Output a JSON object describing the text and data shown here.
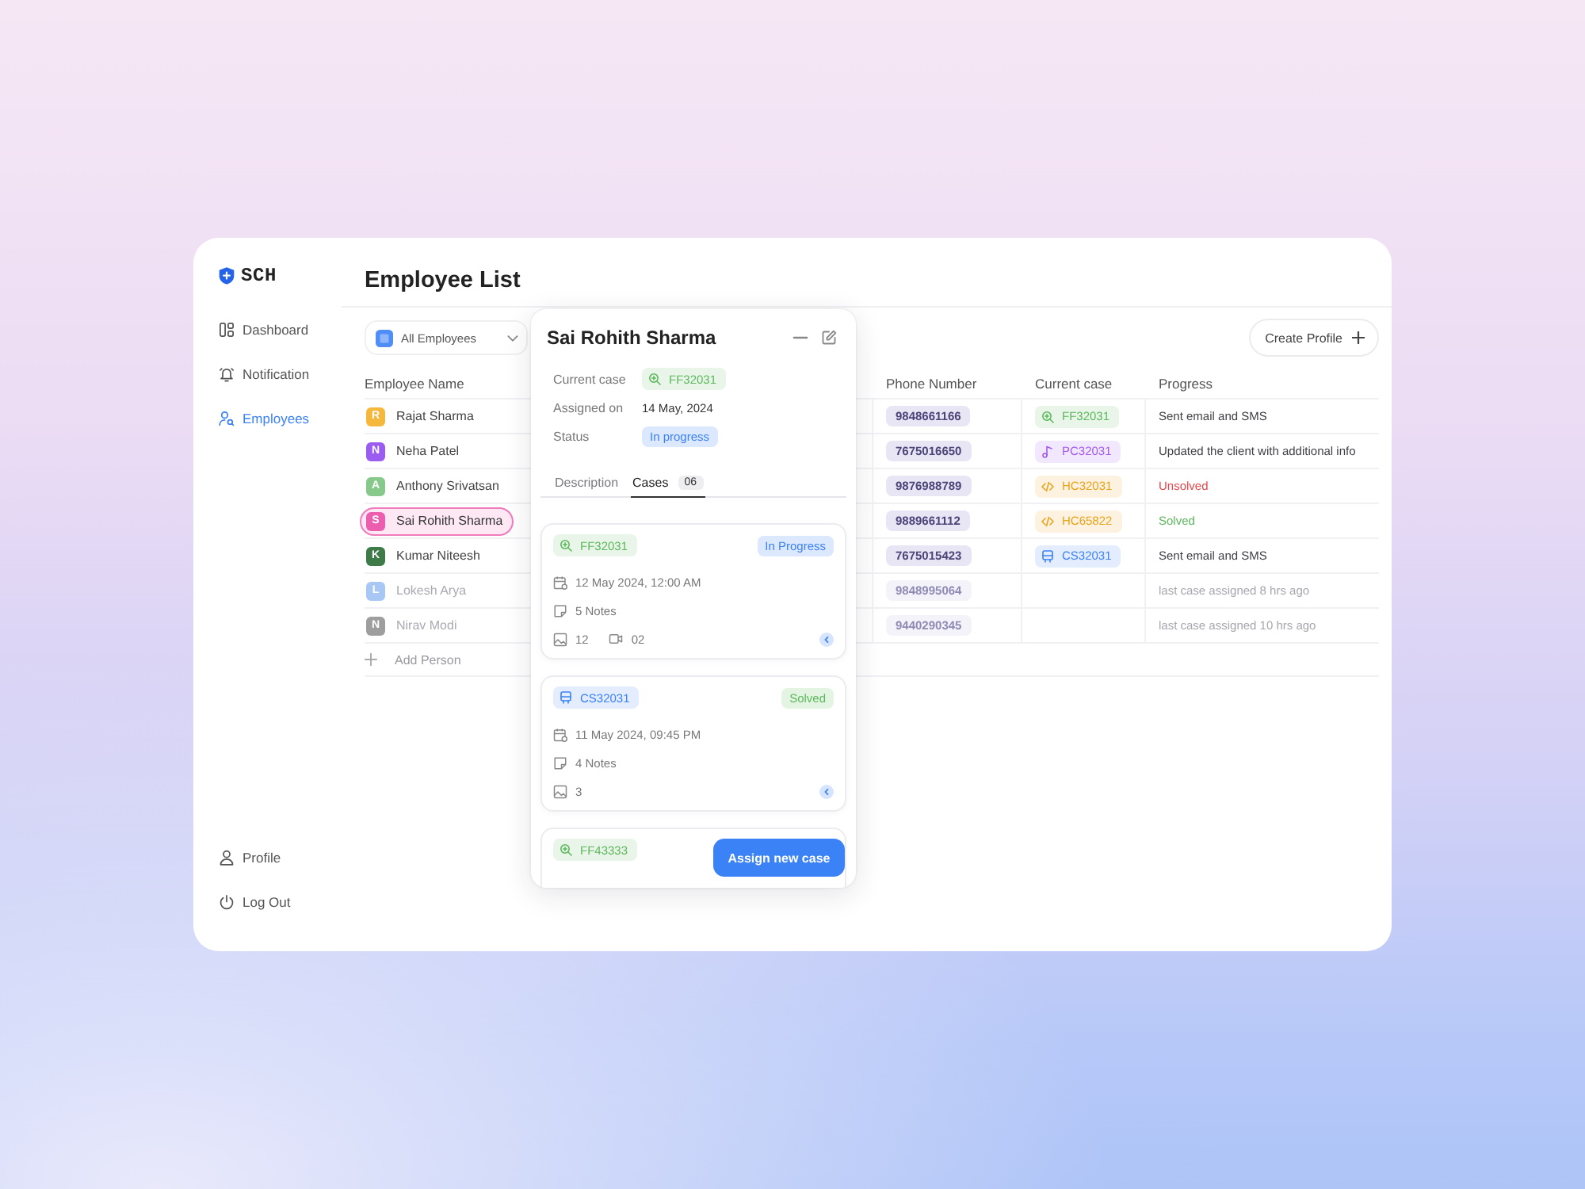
{
  "sidebar": {
    "logo": "SCH",
    "items": [
      {
        "label": "Dashboard",
        "kind": "dashboard",
        "selected": false
      },
      {
        "label": "Notification",
        "kind": "bell",
        "selected": false
      },
      {
        "label": "Employees",
        "kind": "people",
        "selected": true
      }
    ],
    "bottom_items": [
      {
        "label": "Profile",
        "kind": "person"
      },
      {
        "label": "Log Out",
        "kind": "power"
      }
    ]
  },
  "header": {
    "title": "Employee List"
  },
  "toolbar": {
    "filter": "All Employees",
    "create_button": "Create Profile"
  },
  "table": {
    "columns": [
      "Employee Name",
      "Phone Number",
      "Current case",
      "Progress"
    ],
    "rows": [
      {
        "initial": "R",
        "name": "Rajat Sharma",
        "color": "#f5b83d",
        "selected": false,
        "inactive": false,
        "phone": "9848661166",
        "case": {
          "id": "FF32031",
          "kind": "search",
          "color": "#5cb85c"
        },
        "progress": {
          "text": "Sent email and SMS",
          "kind": "normal"
        }
      },
      {
        "initial": "N",
        "name": "Neha Patel",
        "color": "#9b5cf0",
        "selected": false,
        "inactive": false,
        "phone": "7675016650",
        "case": {
          "id": "PC32031",
          "kind": "music",
          "color": "#a259f0"
        },
        "progress": {
          "text": "Updated the client with additional info",
          "kind": "normal"
        }
      },
      {
        "initial": "A",
        "name": "Anthony Srivatsan",
        "color": "#86c98a",
        "selected": false,
        "inactive": false,
        "phone": "9876988789",
        "case": {
          "id": "HC32031",
          "kind": "code",
          "color": "#eaa21c"
        },
        "progress": {
          "text": "Unsolved",
          "kind": "danger"
        }
      },
      {
        "initial": "S",
        "name": "Sai Rohith Sharma",
        "color": "#ec5fae",
        "selected": true,
        "inactive": false,
        "phone": "9889661112",
        "case": {
          "id": "HC65822",
          "kind": "code",
          "color": "#eaa21c"
        },
        "progress": {
          "text": "Solved",
          "kind": "success"
        }
      },
      {
        "initial": "K",
        "name": "Kumar Niteesh",
        "color": "#3f7a49",
        "selected": false,
        "inactive": false,
        "phone": "7675015423",
        "case": {
          "id": "CS32031",
          "kind": "bus",
          "color": "#3b82f6"
        },
        "progress": {
          "text": "Sent email and SMS",
          "kind": "normal"
        }
      },
      {
        "initial": "L",
        "name": "Lokesh Arya",
        "color": "#a9c7f5",
        "selected": false,
        "inactive": true,
        "phone": "9848995064",
        "progress": {
          "text": "last case assigned 8 hrs ago",
          "kind": "muted"
        }
      },
      {
        "initial": "N",
        "name": "Nirav Modi",
        "color": "#9e9e9e",
        "selected": false,
        "inactive": true,
        "phone": "9440290345",
        "progress": {
          "text": "last case assigned 10 hrs ago",
          "kind": "muted"
        }
      }
    ],
    "add_row": "Add Person"
  },
  "detail_panel": {
    "title": "Sai Rohith Sharma",
    "fields": [
      {
        "label": "Current case",
        "kind": "case",
        "case": {
          "id": "FF32031",
          "kind": "search",
          "color": "#5cb85c"
        }
      },
      {
        "label": "Assigned on",
        "kind": "text",
        "value": "14 May, 2024"
      },
      {
        "label": "Status",
        "kind": "badge",
        "value": "In progress"
      }
    ],
    "tabs": [
      {
        "label": "Description",
        "selected": false
      },
      {
        "label": "Cases",
        "count": "06",
        "selected": true
      }
    ],
    "cases": [
      {
        "case": {
          "id": "FF32031",
          "kind": "search",
          "color": "#5cb85c"
        },
        "status": {
          "label": "In Progress",
          "kind": "progress"
        },
        "date": "12 May 2024, 12:00 AM",
        "notes": "5 Notes",
        "images": "12",
        "videos": "02"
      },
      {
        "case": {
          "id": "CS32031",
          "kind": "bus",
          "color": "#3b82f6"
        },
        "status": {
          "label": "Solved",
          "kind": "solved"
        },
        "date": "11 May 2024, 09:45 PM",
        "notes": "4 Notes",
        "images": "3"
      },
      {
        "case": {
          "id": "FF43333",
          "kind": "search",
          "color": "#5cb85c"
        }
      }
    ],
    "assign_button": "Assign new case"
  }
}
